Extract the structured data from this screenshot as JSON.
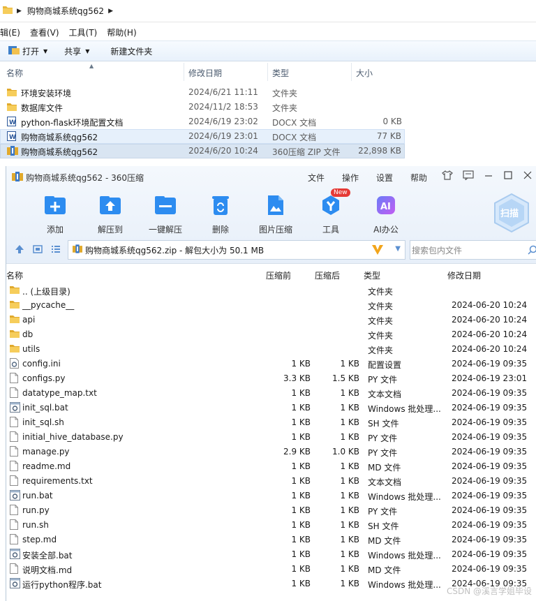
{
  "explorer": {
    "breadcrumb": "购物商城系统qg562",
    "menu": [
      "编辑(E)",
      "查看(V)",
      "工具(T)",
      "帮助(H)"
    ],
    "toolbar": {
      "open": "打开",
      "share": "共享",
      "new_folder": "新建文件夹"
    },
    "columns": {
      "name": "名称",
      "date": "修改日期",
      "type": "类型",
      "size": "大小"
    },
    "rows": [
      {
        "icon": "folder-icon",
        "name": "环境安装环境",
        "date": "2024/6/21 11:11",
        "type": "文件夹",
        "size": ""
      },
      {
        "icon": "folder-icon",
        "name": "数据库文件",
        "date": "2024/11/2 18:53",
        "type": "文件夹",
        "size": ""
      },
      {
        "icon": "word-doc-icon",
        "name": "python-flask环境配置文档",
        "date": "2024/6/19 23:02",
        "type": "DOCX 文档",
        "size": "0 KB"
      },
      {
        "icon": "word-doc-icon",
        "name": "购物商城系统qg562",
        "date": "2024/6/19 23:01",
        "type": "DOCX 文档",
        "size": "77 KB"
      },
      {
        "icon": "zip-archive-icon",
        "name": "购物商城系统qg562",
        "date": "2024/6/20 10:24",
        "type": "360压缩 ZIP 文件",
        "size": "22,898 KB"
      }
    ]
  },
  "zip_window": {
    "title": "购物商城系统qg562 - 360压缩",
    "menu": [
      "文件",
      "操作",
      "设置",
      "帮助"
    ],
    "tools": [
      {
        "icon": "add-icon",
        "label": "添加"
      },
      {
        "icon": "extract-to-icon",
        "label": "解压到"
      },
      {
        "icon": "one-click-extract-icon",
        "label": "一键解压"
      },
      {
        "icon": "delete-icon",
        "label": "删除"
      },
      {
        "icon": "image-compress-icon",
        "label": "图片压缩"
      },
      {
        "icon": "tools-icon",
        "label": "工具"
      },
      {
        "icon": "ai-office-icon",
        "label": "AI办公"
      }
    ],
    "new_badge": "New",
    "scan_label": "扫描",
    "path": "购物商城系统qg562.zip - 解包大小为 50.1 MB",
    "search_placeholder": "搜索包内文件",
    "columns": {
      "name": "名称",
      "before": "压缩前",
      "after": "压缩后",
      "type": "类型",
      "date": "修改日期"
    },
    "rows": [
      {
        "icon": "folder-icon",
        "name": ".. (上级目录)",
        "before": "",
        "after": "",
        "type": "文件夹",
        "date": ""
      },
      {
        "icon": "folder-icon",
        "name": "__pycache__",
        "before": "",
        "after": "",
        "type": "文件夹",
        "date": "2024-06-20 10:24"
      },
      {
        "icon": "folder-icon",
        "name": "api",
        "before": "",
        "after": "",
        "type": "文件夹",
        "date": "2024-06-20 10:24"
      },
      {
        "icon": "folder-icon",
        "name": "db",
        "before": "",
        "after": "",
        "type": "文件夹",
        "date": "2024-06-20 10:24"
      },
      {
        "icon": "folder-icon",
        "name": "utils",
        "before": "",
        "after": "",
        "type": "文件夹",
        "date": "2024-06-20 10:24"
      },
      {
        "icon": "config-file-icon",
        "name": "config.ini",
        "before": "1 KB",
        "after": "1 KB",
        "type": "配置设置",
        "date": "2024-06-19 09:35"
      },
      {
        "icon": "text-file-icon",
        "name": "configs.py",
        "before": "3.3 KB",
        "after": "1.5 KB",
        "type": "PY 文件",
        "date": "2024-06-19 23:01"
      },
      {
        "icon": "text-file-icon",
        "name": "datatype_map.txt",
        "before": "1 KB",
        "after": "1 KB",
        "type": "文本文档",
        "date": "2024-06-19 09:35"
      },
      {
        "icon": "batch-file-icon",
        "name": "init_sql.bat",
        "before": "1 KB",
        "after": "1 KB",
        "type": "Windows 批处理...",
        "date": "2024-06-19 09:35"
      },
      {
        "icon": "text-file-icon",
        "name": "init_sql.sh",
        "before": "1 KB",
        "after": "1 KB",
        "type": "SH 文件",
        "date": "2024-06-19 09:35"
      },
      {
        "icon": "text-file-icon",
        "name": "initial_hive_database.py",
        "before": "1 KB",
        "after": "1 KB",
        "type": "PY 文件",
        "date": "2024-06-19 09:35"
      },
      {
        "icon": "text-file-icon",
        "name": "manage.py",
        "before": "2.9 KB",
        "after": "1.0 KB",
        "type": "PY 文件",
        "date": "2024-06-19 09:35"
      },
      {
        "icon": "text-file-icon",
        "name": "readme.md",
        "before": "1 KB",
        "after": "1 KB",
        "type": "MD 文件",
        "date": "2024-06-19 09:35"
      },
      {
        "icon": "text-file-icon",
        "name": "requirements.txt",
        "before": "1 KB",
        "after": "1 KB",
        "type": "文本文档",
        "date": "2024-06-19 09:35"
      },
      {
        "icon": "batch-file-icon",
        "name": "run.bat",
        "before": "1 KB",
        "after": "1 KB",
        "type": "Windows 批处理...",
        "date": "2024-06-19 09:35"
      },
      {
        "icon": "text-file-icon",
        "name": "run.py",
        "before": "1 KB",
        "after": "1 KB",
        "type": "PY 文件",
        "date": "2024-06-19 09:35"
      },
      {
        "icon": "text-file-icon",
        "name": "run.sh",
        "before": "1 KB",
        "after": "1 KB",
        "type": "SH 文件",
        "date": "2024-06-19 09:35"
      },
      {
        "icon": "text-file-icon",
        "name": "step.md",
        "before": "1 KB",
        "after": "1 KB",
        "type": "MD 文件",
        "date": "2024-06-19 09:35"
      },
      {
        "icon": "batch-file-icon",
        "name": "安装全部.bat",
        "before": "1 KB",
        "after": "1 KB",
        "type": "Windows 批处理...",
        "date": "2024-06-19 09:35"
      },
      {
        "icon": "text-file-icon",
        "name": "说明文档.md",
        "before": "1 KB",
        "after": "1 KB",
        "type": "MD 文件",
        "date": "2024-06-19 09:35"
      },
      {
        "icon": "batch-file-icon",
        "name": "运行python程序.bat",
        "before": "1 KB",
        "after": "1 KB",
        "type": "Windows 批处理...",
        "date": "2024-06-19 09:35"
      }
    ]
  },
  "watermark": "CSDN @溪言学姐毕设",
  "colors": {
    "accent": "#2d8cf0",
    "folder": "#f2c14e",
    "badge": "#e53935",
    "toolbar_bg": "#e8f1fb"
  }
}
